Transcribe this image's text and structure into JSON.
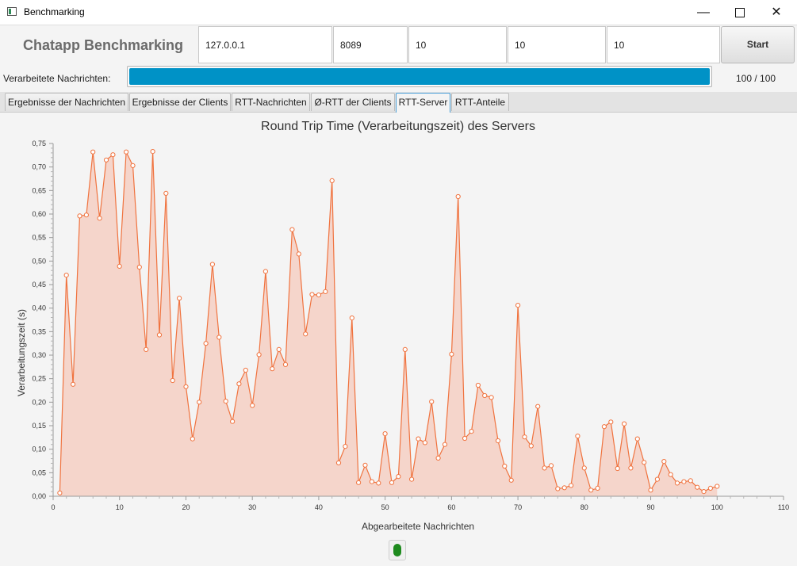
{
  "window": {
    "title": "Benchmarking"
  },
  "header": {
    "app_title": "Chatapp Benchmarking",
    "fields": [
      "127.0.0.1",
      "8089",
      "10",
      "10",
      "10"
    ],
    "start_label": "Start"
  },
  "progress": {
    "label": "Verarbeitete Nachrichten:",
    "text": "100 / 100",
    "fraction": 1.0
  },
  "tabs": [
    "Ergebnisse der Nachrichten",
    "Ergebnisse der Clients",
    "RTT-Nachrichten",
    "Ø-RTT der Clients",
    "RTT-Server",
    "RTT-Anteile"
  ],
  "active_tab": 4,
  "status": {
    "color": "#1e8a1e"
  },
  "chart_data": {
    "type": "area",
    "title": "Round Trip Time (Verarbeitungszeit) des Servers",
    "xlabel": "Abgearbeitete Nachrichten",
    "ylabel": "Verarbeitungszeit (s)",
    "xlim": [
      0,
      110
    ],
    "ylim": [
      0,
      0.75
    ],
    "x_ticks": [
      "0",
      "10",
      "20",
      "30",
      "40",
      "50",
      "60",
      "70",
      "80",
      "90",
      "100",
      "110"
    ],
    "y_ticks": [
      "0,00",
      "0,05",
      "0,10",
      "0,15",
      "0,20",
      "0,25",
      "0,30",
      "0,35",
      "0,40",
      "0,45",
      "0,50",
      "0,55",
      "0,60",
      "0,65",
      "0,70",
      "0,75"
    ],
    "grid": false,
    "color": "#f0733f",
    "fill": "#f5d5cb",
    "x": [
      1,
      2,
      3,
      4,
      5,
      6,
      7,
      8,
      9,
      10,
      11,
      12,
      13,
      14,
      15,
      16,
      17,
      18,
      19,
      20,
      21,
      22,
      23,
      24,
      25,
      26,
      27,
      28,
      29,
      30,
      31,
      32,
      33,
      34,
      35,
      36,
      37,
      38,
      39,
      40,
      41,
      42,
      43,
      44,
      45,
      46,
      47,
      48,
      49,
      50,
      51,
      52,
      53,
      54,
      55,
      56,
      57,
      58,
      59,
      60,
      61,
      62,
      63,
      64,
      65,
      66,
      67,
      68,
      69,
      70,
      71,
      72,
      73,
      74,
      75,
      76,
      77,
      78,
      79,
      80,
      81,
      82,
      83,
      84,
      85,
      86,
      87,
      88,
      89,
      90,
      91,
      92,
      93,
      94,
      95,
      96,
      97,
      98,
      99,
      100
    ],
    "y": [
      0.007,
      0.47,
      0.238,
      0.596,
      0.598,
      0.732,
      0.591,
      0.715,
      0.726,
      0.489,
      0.732,
      0.703,
      0.487,
      0.312,
      0.733,
      0.343,
      0.644,
      0.246,
      0.421,
      0.233,
      0.122,
      0.2,
      0.325,
      0.493,
      0.338,
      0.202,
      0.159,
      0.239,
      0.268,
      0.193,
      0.301,
      0.478,
      0.271,
      0.312,
      0.28,
      0.567,
      0.515,
      0.345,
      0.429,
      0.428,
      0.435,
      0.671,
      0.071,
      0.106,
      0.379,
      0.029,
      0.066,
      0.031,
      0.028,
      0.133,
      0.029,
      0.042,
      0.312,
      0.036,
      0.122,
      0.114,
      0.201,
      0.081,
      0.11,
      0.302,
      0.637,
      0.123,
      0.138,
      0.236,
      0.214,
      0.21,
      0.118,
      0.064,
      0.034,
      0.406,
      0.126,
      0.107,
      0.191,
      0.06,
      0.065,
      0.016,
      0.018,
      0.023,
      0.128,
      0.06,
      0.013,
      0.017,
      0.148,
      0.158,
      0.059,
      0.154,
      0.06,
      0.122,
      0.072,
      0.013,
      0.036,
      0.074,
      0.046,
      0.028,
      0.031,
      0.033,
      0.019,
      0.01,
      0.017,
      0.021
    ]
  }
}
